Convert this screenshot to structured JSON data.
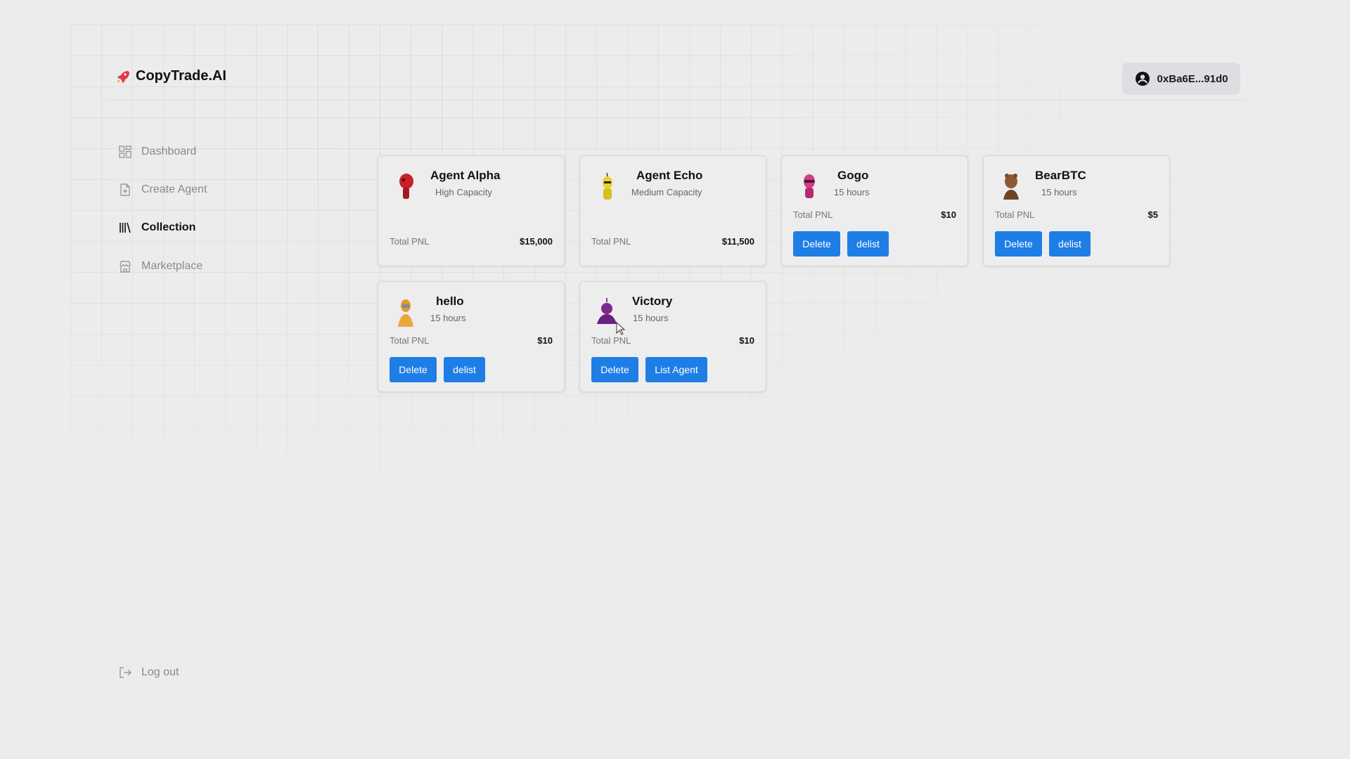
{
  "app": {
    "brand": "CopyTrade.AI",
    "wallet": "0xBa6E...91d0",
    "accent": "#1e7ee6"
  },
  "nav": {
    "items": [
      {
        "label": "Dashboard",
        "icon": "grid-icon"
      },
      {
        "label": "Create Agent",
        "icon": "file-plus-icon"
      },
      {
        "label": "Collection",
        "icon": "library-icon",
        "active": true
      },
      {
        "label": "Marketplace",
        "icon": "store-icon"
      }
    ],
    "logout": "Log out"
  },
  "cards": [
    {
      "name": "Agent Alpha",
      "subtitle": "High Capacity",
      "pnl_label": "Total PNL",
      "pnl": "$15,000",
      "color": "#c8202a"
    },
    {
      "name": "Agent Echo",
      "subtitle": "Medium Capacity",
      "pnl_label": "Total PNL",
      "pnl": "$11,500",
      "color": "#e8d32c"
    },
    {
      "name": "Gogo",
      "subtitle": "15 hours",
      "pnl_label": "Total PNL",
      "pnl": "$10",
      "actions": [
        "Delete",
        "delist"
      ],
      "color": "#d63b8a"
    },
    {
      "name": "BearBTC",
      "subtitle": "15 hours",
      "pnl_label": "Total PNL",
      "pnl": "$5",
      "actions": [
        "Delete",
        "delist"
      ],
      "color": "#8b5a35"
    },
    {
      "name": "hello",
      "subtitle": "15 hours",
      "pnl_label": "Total PNL",
      "pnl": "$10",
      "actions": [
        "Delete",
        "delist"
      ],
      "color": "#e09a2e"
    },
    {
      "name": "Victory",
      "subtitle": "15 hours",
      "pnl_label": "Total PNL",
      "pnl": "$10",
      "actions": [
        "Delete",
        "List Agent"
      ],
      "color": "#7a2a8c"
    }
  ]
}
